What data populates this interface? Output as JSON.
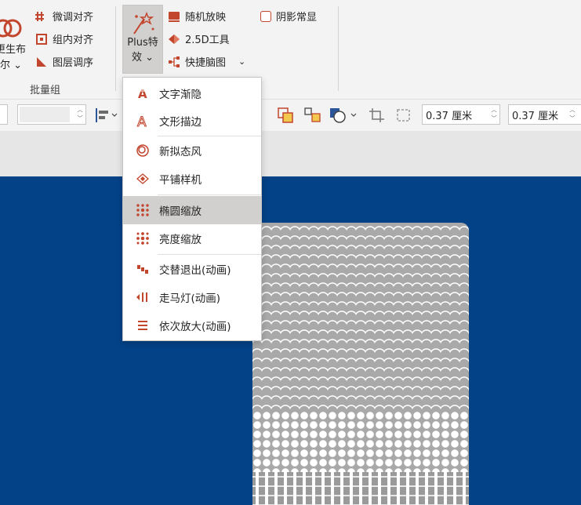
{
  "ribbon": {
    "left_partial": {
      "line1": "更生布",
      "line2": "尔",
      "line1_partial_glyph": "页"
    },
    "batch_group": {
      "label": "批量组",
      "items": [
        {
          "icon": "fine-align-icon",
          "label": "微调对齐"
        },
        {
          "icon": "group-align-icon",
          "label": "组内对齐"
        },
        {
          "icon": "layer-order-icon",
          "label": "图层调序"
        }
      ]
    },
    "plus_button": {
      "line1": "Plus特",
      "line2": "效",
      "chevron": "⌄"
    },
    "plus_group": {
      "items": [
        {
          "icon": "random-slideshow-icon",
          "label": "随机放映"
        },
        {
          "icon": "tool-25d-icon",
          "label": "2.5D工具"
        },
        {
          "icon": "mindmap-icon",
          "label": "快捷脑图",
          "has_dropdown": true
        }
      ],
      "checkbox": {
        "label": "阴影常显",
        "checked": false
      }
    }
  },
  "format_bar": {
    "width_value": "0.37 厘米",
    "height_value": "0.37 厘米"
  },
  "menu": {
    "items": [
      {
        "icon": "text-fade-icon",
        "label": "文字渐隐",
        "highlighted": false
      },
      {
        "icon": "text-outline-icon",
        "label": "文形描边",
        "highlighted": false
      },
      {
        "icon": "neumorphism-icon",
        "label": "新拟态风",
        "highlighted": false
      },
      {
        "icon": "tile-sampler-icon",
        "label": "平铺样机",
        "highlighted": false
      },
      {
        "icon": "ellipse-zoom-icon",
        "label": "椭圆缩放",
        "highlighted": true
      },
      {
        "icon": "brightness-zoom-icon",
        "label": "亮度缩放",
        "highlighted": false
      },
      {
        "icon": "alternate-exit-icon",
        "label": "交替退出(动画)",
        "highlighted": false
      },
      {
        "icon": "marquee-icon",
        "label": "走马灯(动画)",
        "highlighted": false
      },
      {
        "icon": "sequential-zoom-icon",
        "label": "依次放大(动画)",
        "highlighted": false
      }
    ]
  },
  "colors": {
    "accent": "#c2452d",
    "slide_background": "#034287",
    "ribbon_background": "#f3f3f3",
    "menu_highlight": "#d2d0ce"
  }
}
